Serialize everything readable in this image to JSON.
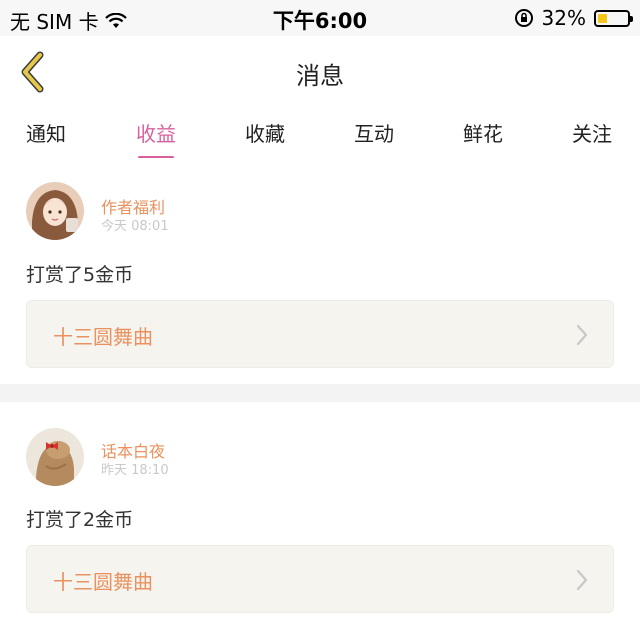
{
  "status_bar": {
    "carrier": "无 SIM 卡",
    "time": "下午6:00",
    "battery_percent": "32%",
    "battery_level": 0.32,
    "icons": [
      "wifi-icon",
      "rotation-lock-icon",
      "battery-icon"
    ]
  },
  "nav": {
    "title": "消息",
    "back_icon": "chevron-left-icon",
    "back_color": "#e6c84a"
  },
  "tabs": [
    {
      "label": "通知",
      "active": false
    },
    {
      "label": "收益",
      "active": true
    },
    {
      "label": "收藏",
      "active": false
    },
    {
      "label": "互动",
      "active": false
    },
    {
      "label": "鲜花",
      "active": false
    },
    {
      "label": "关注",
      "active": false
    }
  ],
  "colors": {
    "accent_pink": "#d9609f",
    "author_orange": "#e9925f",
    "back_yellow": "#e6c84a",
    "ref_bg": "#f5f4ef"
  },
  "messages": [
    {
      "author": "作者福利",
      "time": "今天 08:01",
      "text": "打赏了5金币",
      "ref_title": "十三圆舞曲",
      "avatar_icon": "avatar-illustration-icon"
    },
    {
      "author": "话本白夜",
      "time": "昨天 18:10",
      "text": "打赏了2金币",
      "ref_title": "十三圆舞曲",
      "avatar_icon": "avatar-photo-icon"
    }
  ]
}
